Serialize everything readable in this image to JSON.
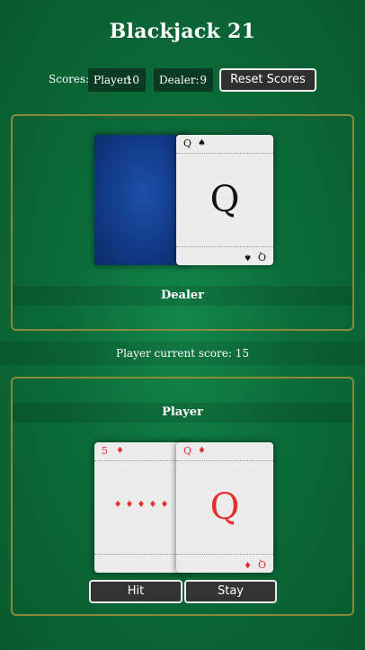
{
  "title": "Blackjack 21",
  "scores": {
    "label": "Scores:",
    "player_label": "Player:",
    "player_value": "10",
    "dealer_label": "Dealer:",
    "dealer_value": "9",
    "reset_label": "Reset Scores"
  },
  "dealer": {
    "heading": "Dealer",
    "cards": [
      {
        "face_down": true
      },
      {
        "rank": "Q",
        "suit": "♠",
        "color": "#111111"
      }
    ]
  },
  "status_text": "Player current score: 15",
  "player": {
    "heading": "Player",
    "cards": [
      {
        "rank": "5",
        "suit": "♦",
        "pips": "♦♦♦♦♦",
        "color": "#e53030"
      },
      {
        "rank": "Q",
        "suit": "♦",
        "color": "#e53030"
      }
    ],
    "hit_label": "Hit",
    "stay_label": "Stay"
  },
  "colors": {
    "felt": "#0c6b3a",
    "panel_border": "#8a8a3a",
    "card_back": "#123a88",
    "red_suit": "#e53030"
  }
}
